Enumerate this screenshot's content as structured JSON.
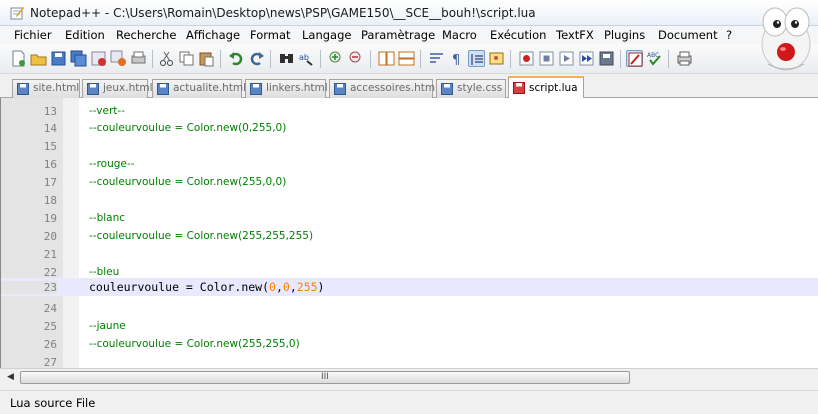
{
  "window": {
    "title": "Notepad++ - C:\\Users\\Romain\\Desktop\\news\\PSP\\GAME150\\__SCE__bouh!\\script.lua"
  },
  "menu": [
    "Fichier",
    "Edition",
    "Recherche",
    "Affichage",
    "Format",
    "Langage",
    "Paramètrage",
    "Macro",
    "Exécution",
    "TextFX",
    "Plugins",
    "Document",
    "?"
  ],
  "toolbar": {
    "icons": [
      "new-file-icon",
      "open-file-icon",
      "save-icon",
      "save-all-icon",
      "close-icon",
      "close-all-icon",
      "print-icon",
      "cut-icon",
      "copy-icon",
      "paste-icon",
      "undo-icon",
      "redo-icon",
      "find-icon",
      "replace-icon",
      "zoom-in-icon",
      "zoom-out-icon",
      "sync-vertical-icon",
      "sync-horizontal-icon",
      "word-wrap-icon",
      "show-all-chars-icon",
      "indent-guide-icon",
      "user-lang-icon",
      "record-macro-icon",
      "stop-macro-icon",
      "play-macro-icon",
      "play-macro-multiple-icon",
      "save-macro-icon",
      "launch-icon",
      "spellcheck-icon",
      "print-now-icon"
    ]
  },
  "tabs": [
    {
      "label": "site.html",
      "active": false
    },
    {
      "label": "jeux.html",
      "active": false
    },
    {
      "label": "actualite.html",
      "active": false
    },
    {
      "label": "linkers.html",
      "active": false
    },
    {
      "label": "accessoires.html",
      "active": false
    },
    {
      "label": "style.css",
      "active": false
    },
    {
      "label": "script.lua",
      "active": true
    }
  ],
  "editor": {
    "lines": [
      {
        "n": "13",
        "text": "--vert--"
      },
      {
        "n": "14",
        "text": "--couleurvoulue = Color.new(0,255,0)"
      },
      {
        "n": "15",
        "text": ""
      },
      {
        "n": "16",
        "text": "--rouge--"
      },
      {
        "n": "17",
        "text": "--couleurvoulue = Color.new(255,0,0)"
      },
      {
        "n": "18",
        "text": ""
      },
      {
        "n": "19",
        "text": "--blanc"
      },
      {
        "n": "20",
        "text": "--couleurvoulue = Color.new(255,255,255)"
      },
      {
        "n": "21",
        "text": ""
      },
      {
        "n": "22",
        "text": "--bleu"
      },
      {
        "n": "23",
        "text": "couleurvoulue = Color.new(0,0,255)",
        "current": true
      },
      {
        "n": "24",
        "text": ""
      },
      {
        "n": "25",
        "text": "--jaune"
      },
      {
        "n": "26",
        "text": "--couleurvoulue = Color.new(255,255,0)"
      },
      {
        "n": "27",
        "text": ""
      }
    ],
    "current_line": {
      "prefix": "couleurvoulue = Color.new(",
      "a": "0",
      "b": "0",
      "c": "255",
      "suffix": ")"
    }
  },
  "scrollbar": {
    "grip": "III"
  },
  "status": {
    "filetype": "Lua source File"
  },
  "colors": {
    "comment": "#008000",
    "number": "#ff8000",
    "current_line_bg": "#e8e8ff",
    "active_tab_accent": "#f7b050"
  }
}
